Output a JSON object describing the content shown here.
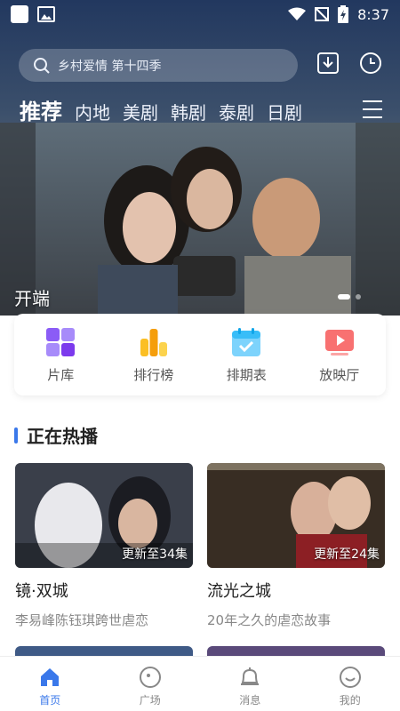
{
  "status_bar": {
    "time": "8:37"
  },
  "search": {
    "placeholder": "乡村爱情 第十四季"
  },
  "tabs": [
    {
      "label": "推荐",
      "active": true
    },
    {
      "label": "内地"
    },
    {
      "label": "美剧"
    },
    {
      "label": "韩剧"
    },
    {
      "label": "泰剧"
    },
    {
      "label": "日剧"
    }
  ],
  "hero": {
    "title": "开端"
  },
  "quick_entries": [
    {
      "label": "片库",
      "icon": "grid-icon",
      "color": "#8b5cf6"
    },
    {
      "label": "排行榜",
      "icon": "bar-chart-icon",
      "color": "#f59e0b"
    },
    {
      "label": "排期表",
      "icon": "calendar-check-icon",
      "color": "#38bdf8"
    },
    {
      "label": "放映厅",
      "icon": "play-screen-icon",
      "color": "#ef4444"
    }
  ],
  "section": {
    "title": "正在热播",
    "accent": "#3a78ea"
  },
  "shows": [
    {
      "title": "镜·双城",
      "subtitle": "李易峰陈钰琪跨世虐恋",
      "badge": "更新至34集"
    },
    {
      "title": "流光之城",
      "subtitle": "20年之久的虐恋故事",
      "badge": "更新至24集"
    }
  ],
  "bottom_nav": [
    {
      "label": "首页",
      "icon": "home-icon",
      "active": true
    },
    {
      "label": "广场",
      "icon": "compass-icon"
    },
    {
      "label": "消息",
      "icon": "bell-icon"
    },
    {
      "label": "我的",
      "icon": "smile-icon"
    }
  ]
}
